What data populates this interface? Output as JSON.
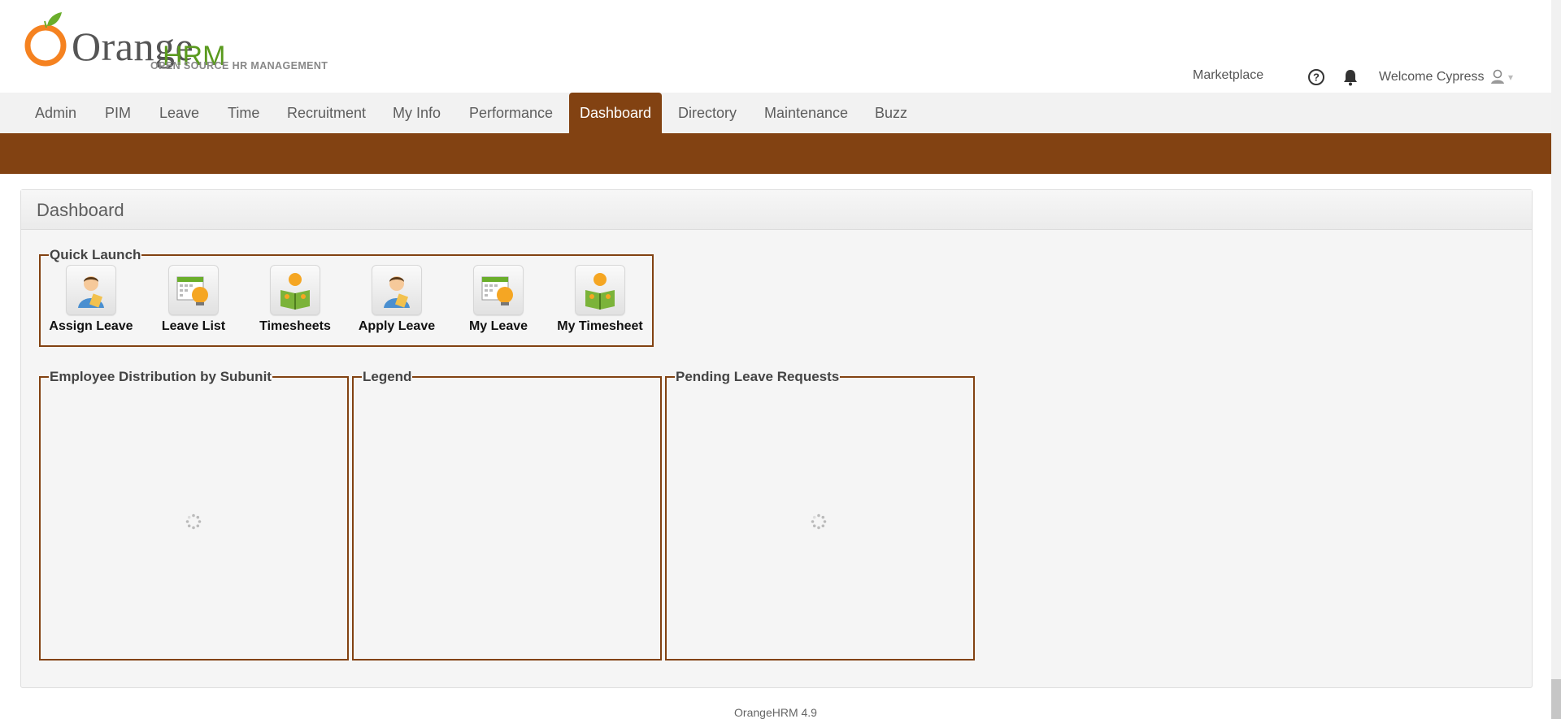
{
  "brand": {
    "word_orange": "Orange",
    "word_hrm": "HRM",
    "tagline": "OPEN SOURCE HR MANAGEMENT",
    "orange_color": "#f58220",
    "leaf_color": "#6aae2b"
  },
  "top_links": {
    "marketplace": "Marketplace",
    "welcome": "Welcome Cypress",
    "caret": "▾"
  },
  "menu": {
    "items": [
      {
        "label": "Admin"
      },
      {
        "label": "PIM"
      },
      {
        "label": "Leave"
      },
      {
        "label": "Time"
      },
      {
        "label": "Recruitment"
      },
      {
        "label": "My Info"
      },
      {
        "label": "Performance"
      },
      {
        "label": "Dashboard",
        "active": true
      },
      {
        "label": "Directory"
      },
      {
        "label": "Maintenance"
      },
      {
        "label": "Buzz"
      }
    ],
    "active_color": "#824212"
  },
  "dashboard": {
    "title": "Dashboard",
    "quick_launch": {
      "legend": "Quick Launch",
      "items": [
        {
          "label": "Assign Leave",
          "icon": "person-document-icon"
        },
        {
          "label": "Leave List",
          "icon": "calendar-orange-icon"
        },
        {
          "label": "Timesheets",
          "icon": "person-book-icon"
        },
        {
          "label": "Apply Leave",
          "icon": "person-document-icon"
        },
        {
          "label": "My Leave",
          "icon": "calendar-orange-icon"
        },
        {
          "label": "My Timesheet",
          "icon": "person-book-icon"
        }
      ]
    },
    "panels": {
      "employee_distribution": "Employee Distribution by Subunit",
      "legend": "Legend",
      "pending_leave": "Pending Leave Requests"
    }
  },
  "footer": {
    "version": "OrangeHRM 4.9"
  }
}
